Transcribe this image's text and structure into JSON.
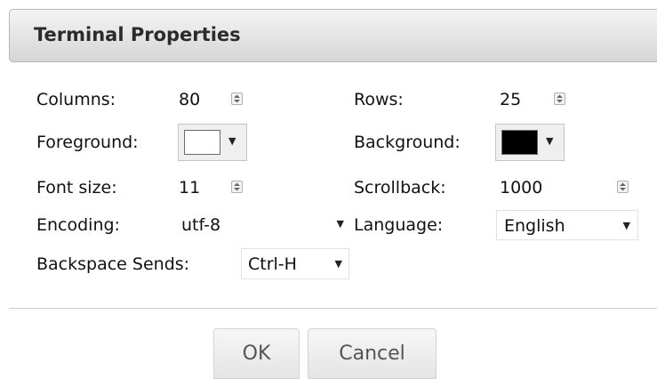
{
  "dialog": {
    "title": "Terminal Properties"
  },
  "fields": {
    "columns": {
      "label": "Columns:",
      "value": "80"
    },
    "rows": {
      "label": "Rows:",
      "value": "25"
    },
    "foreground": {
      "label": "Foreground:",
      "color": "#ffffff"
    },
    "background": {
      "label": "Background:",
      "color": "#000000"
    },
    "font_size": {
      "label": "Font size:",
      "value": "11"
    },
    "scrollback": {
      "label": "Scrollback:",
      "value": "1000"
    },
    "encoding": {
      "label": "Encoding:",
      "value": "utf-8"
    },
    "language": {
      "label": "Language:",
      "value": "English"
    },
    "backspace": {
      "label": "Backspace Sends:",
      "value": "Ctrl-H"
    }
  },
  "buttons": {
    "ok": "OK",
    "cancel": "Cancel"
  }
}
